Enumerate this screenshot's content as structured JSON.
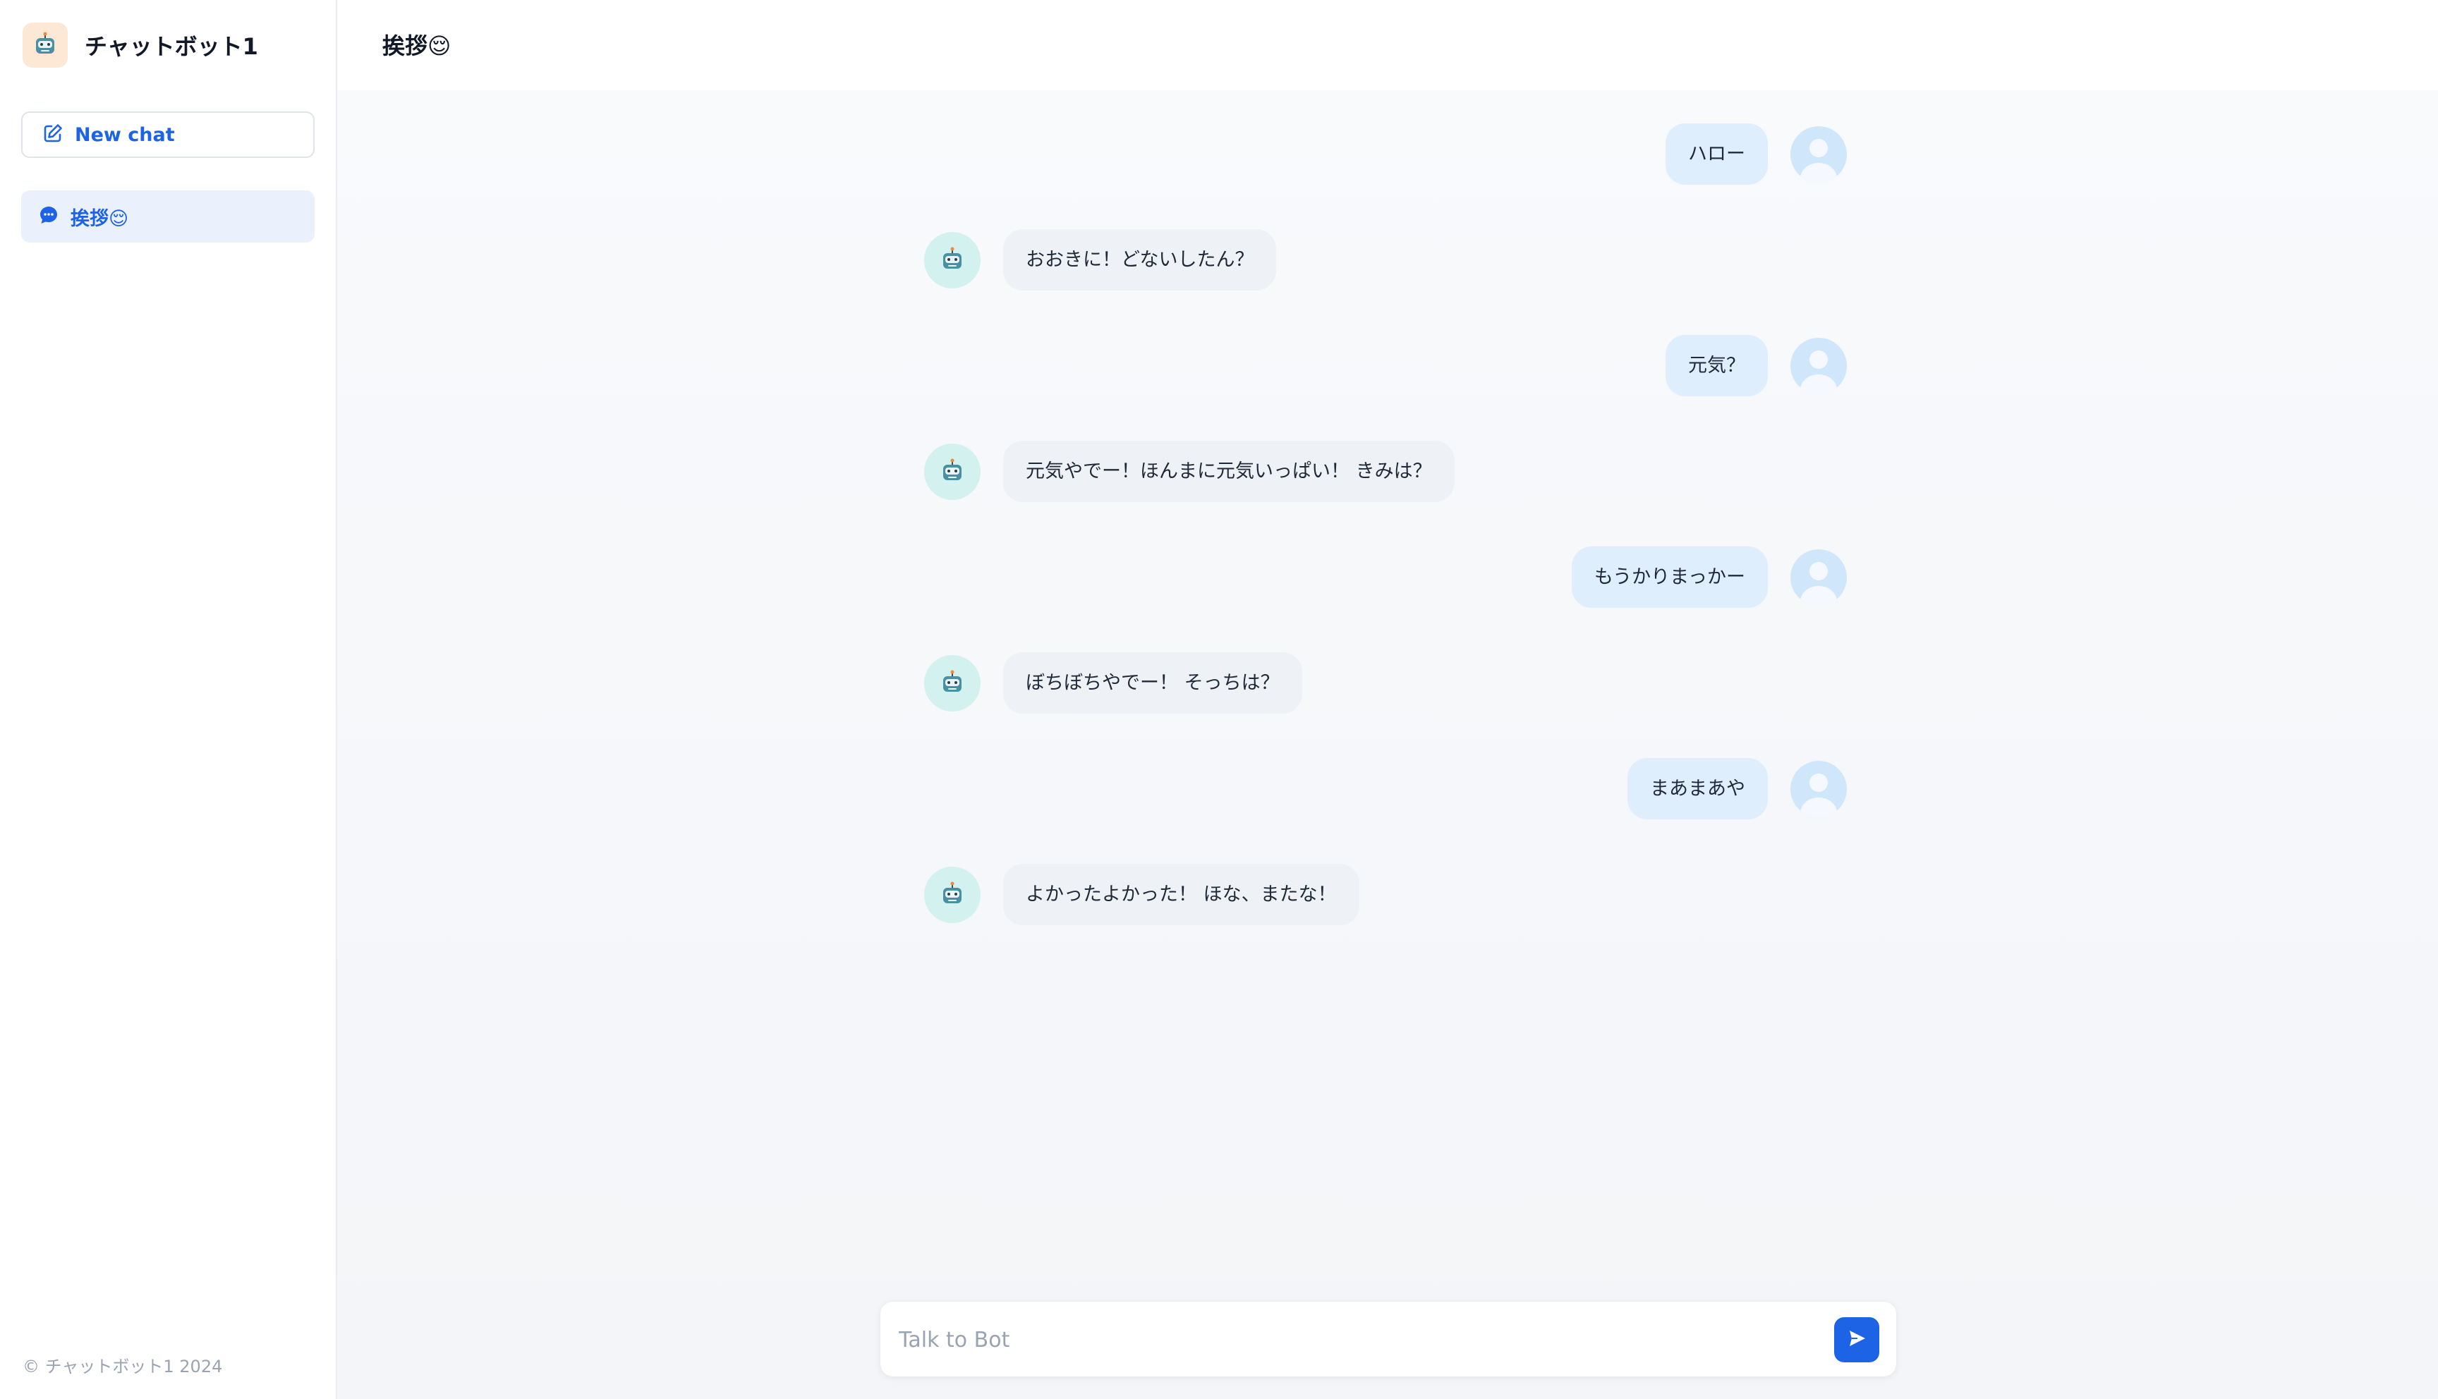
{
  "sidebar": {
    "app_name": "チャットボット1",
    "new_chat_label": "New chat",
    "history": [
      {
        "label": "挨拶😌"
      }
    ],
    "copyright": "© チャットボット1 2024"
  },
  "chat": {
    "title": "挨拶😌",
    "messages": [
      {
        "role": "user",
        "text": "ハロー"
      },
      {
        "role": "bot",
        "text": "おおきに！どないしたん？"
      },
      {
        "role": "user",
        "text": "元気？"
      },
      {
        "role": "bot",
        "text": "元気やでー！ほんまに元気いっぱい！ きみは？"
      },
      {
        "role": "user",
        "text": "もうかりまっかー"
      },
      {
        "role": "bot",
        "text": "ぼちぼちやでー！ そっちは？"
      },
      {
        "role": "user",
        "text": "まあまあや"
      },
      {
        "role": "bot",
        "text": "よかったよかった！ ほな、またな！"
      }
    ]
  },
  "input": {
    "placeholder": "Talk to Bot",
    "value": ""
  },
  "icons": {
    "brand": "robot-icon",
    "new_chat": "edit-icon",
    "history": "chat-bubble-icon",
    "send": "send-icon",
    "user_avatar": "user-avatar-icon",
    "bot_avatar": "robot-icon"
  },
  "colors": {
    "accent": "#1d63e6",
    "user_bubble": "#dfeefd",
    "bot_bubble": "#eef1f5",
    "history_active": "#eaf1fd"
  }
}
